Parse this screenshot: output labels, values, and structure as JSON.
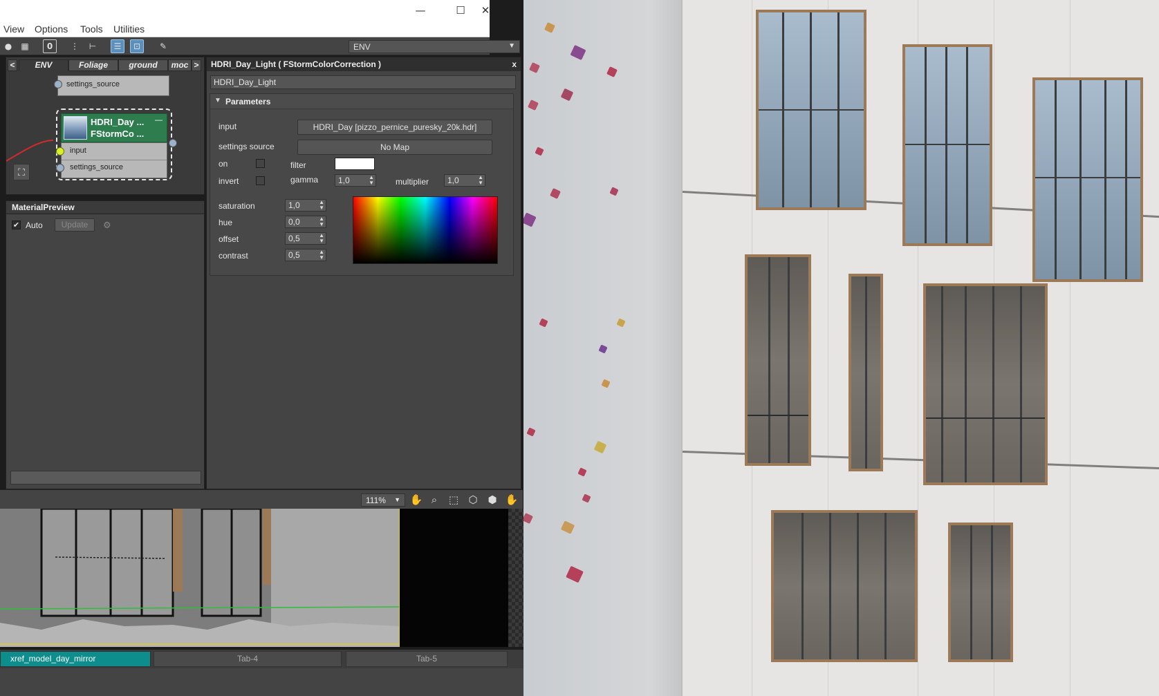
{
  "menu": [
    "View",
    "Options",
    "Tools",
    "Utilities"
  ],
  "window_controls": {
    "minimize": "—",
    "maximize": "☐",
    "close": "✕"
  },
  "toolbar": {
    "counter": "0",
    "env_select": "ENV"
  },
  "node_view": {
    "tabs": [
      "ENV",
      "Foliage",
      "ground",
      "moc"
    ],
    "tab_prev": "<",
    "tab_next": ">",
    "small_node_socket": "settings_source",
    "main_node": {
      "title_line1": "HDRI_Day ...",
      "title_line2": "FStormCo ...",
      "collapse": "—",
      "socket_input": "input",
      "socket_settings": "settings_source"
    }
  },
  "material_preview": {
    "title": "MaterialPreview",
    "auto_label": "Auto",
    "auto_checked": true,
    "update_label": "Update"
  },
  "params": {
    "title": "HDRI_Day_Light  ( FStormColorCorrection )",
    "close": "x",
    "name": "HDRI_Day_Light",
    "rollout": "Parameters",
    "input_label": "input",
    "input_value": "HDRI_Day [pizzo_pernice_puresky_20k.hdr]",
    "settings_source_label": "settings source",
    "settings_source_value": "No Map",
    "on_label": "on",
    "filter_label": "filter",
    "invert_label": "invert",
    "gamma_label": "gamma",
    "gamma_value": "1,0",
    "multiplier_label": "multiplier",
    "multiplier_value": "1,0",
    "saturation_label": "saturation",
    "saturation_value": "1,0",
    "hue_label": "hue",
    "hue_value": "0,0",
    "offset_label": "offset",
    "offset_value": "0,5",
    "contrast_label": "contrast",
    "contrast_value": "0,5",
    "filter_color": "#ffffff"
  },
  "viewport": {
    "zoom": "111%"
  },
  "bottom_tabs": [
    "xref_model_day_mirror",
    "Tab-4",
    "Tab-5"
  ],
  "colors": {
    "node_header": "#2e7d4f",
    "active_tab": "#0e8d8d",
    "toggle_on": "#5b8fbe",
    "wood_frame": "#9c7a57"
  }
}
